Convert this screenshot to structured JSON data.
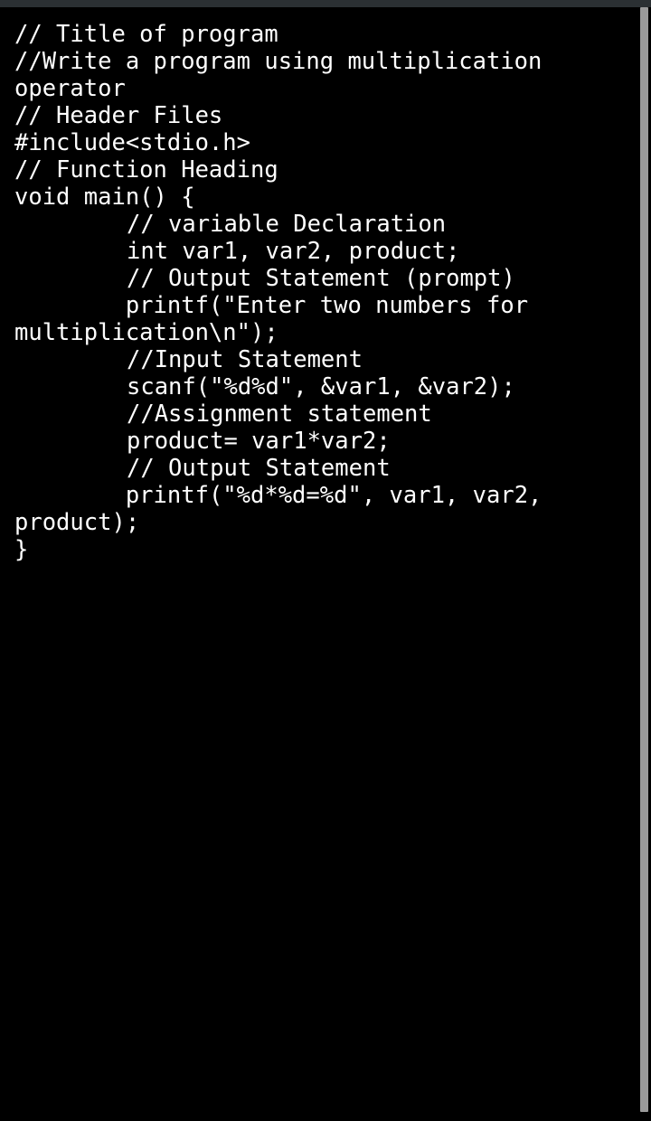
{
  "editor": {
    "lines": [
      "// Title of program",
      "//Write a program using multiplication operator",
      "// Header Files",
      "#include<stdio.h>",
      "// Function Heading",
      "void main() {",
      "// variable Declaration",
      "int var1, var2, product;",
      "// Output Statement (prompt)",
      "printf(\"Enter two numbers for multiplication\\n\");",
      "//Input Statement",
      "scanf(\"%d%d\", &var1, &var2);",
      "//Assignment statement",
      "product= var1*var2;",
      "// Output Statement",
      "printf(\"%d*%d=%d\", var1, var2, product);",
      "}"
    ]
  }
}
